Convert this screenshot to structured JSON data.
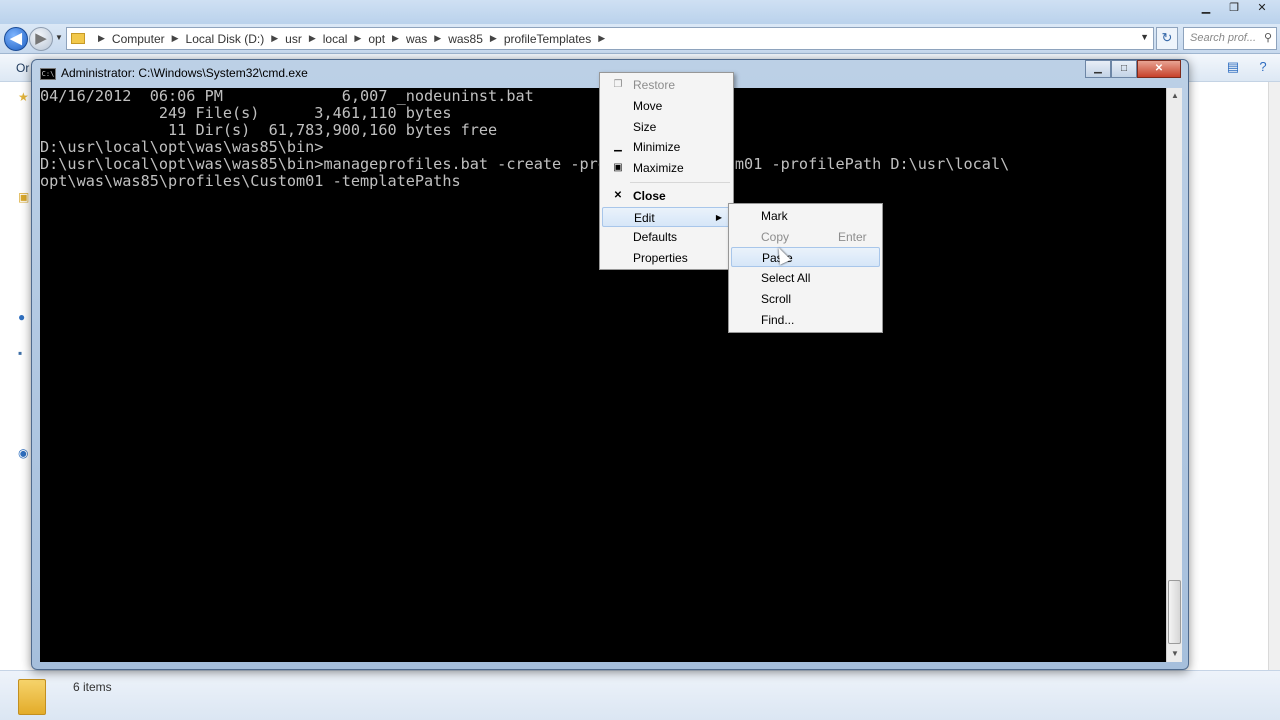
{
  "explorer": {
    "breadcrumb": [
      "Computer",
      "Local Disk (D:)",
      "usr",
      "local",
      "opt",
      "was",
      "was85",
      "profileTemplates"
    ],
    "search_placeholder": "Search prof...",
    "toolbar_organize": "Or",
    "status_items": "6 items"
  },
  "cmd": {
    "title": "Administrator: C:\\Windows\\System32\\cmd.exe",
    "lines": [
      "04/16/2012  06:06 PM             6,007 _nodeuninst.bat",
      "             249 File(s)      3,461,110 bytes",
      "              11 Dir(s)  61,783,900,160 bytes free",
      "",
      "D:\\usr\\local\\opt\\was\\was85\\bin>",
      "D:\\usr\\local\\opt\\was\\was85\\bin>manageprofiles.bat -create -profileName Custom01 -profilePath D:\\usr\\local\\",
      "opt\\was\\was85\\profiles\\Custom01 -templatePaths"
    ]
  },
  "system_menu": {
    "restore": "Restore",
    "move": "Move",
    "size": "Size",
    "minimize": "Minimize",
    "maximize": "Maximize",
    "close": "Close",
    "edit": "Edit",
    "defaults": "Defaults",
    "properties": "Properties"
  },
  "edit_menu": {
    "mark": "Mark",
    "copy": "Copy",
    "copy_shortcut": "Enter",
    "paste": "Paste",
    "select_all": "Select All",
    "scroll": "Scroll",
    "find": "Find..."
  }
}
